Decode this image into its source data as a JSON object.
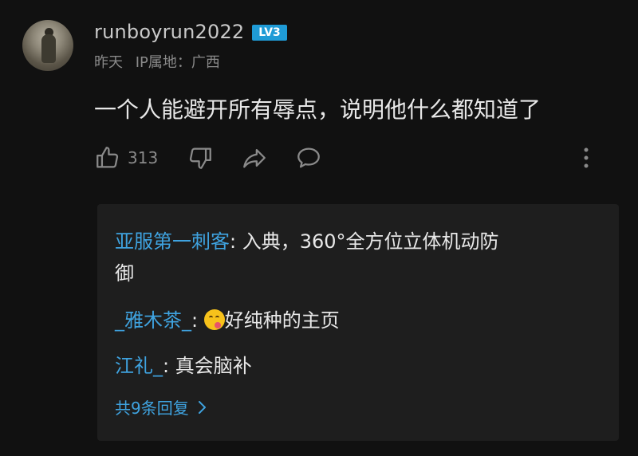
{
  "post": {
    "username": "runboyrun2022",
    "level_badge": "LV3",
    "time": "昨天",
    "ip_location": "IP属地：广西",
    "comment": "一个人能避开所有辱点，说明他什么都知道了",
    "like_count": "313"
  },
  "replies": [
    {
      "user": "亚服第一刺客",
      "sep": ": ",
      "text": "入典，360°全方位立体机动防",
      "text2": "御"
    },
    {
      "user": "_雅木茶_",
      "sep": ": ",
      "text": "好纯种的主页"
    },
    {
      "user": "江礼_",
      "sep": ": ",
      "text": "真会脑补"
    }
  ],
  "more_replies_label": "共9条回复",
  "colors": {
    "accent": "#3fa3e0",
    "badge": "#1f9bd6",
    "background": "#111111",
    "panel": "#1e1e1e"
  },
  "icons": [
    "thumbs-up-icon",
    "thumbs-down-icon",
    "share-icon",
    "comment-icon",
    "more-vertical-icon",
    "chevron-right-icon",
    "savoring-food-emoji"
  ]
}
